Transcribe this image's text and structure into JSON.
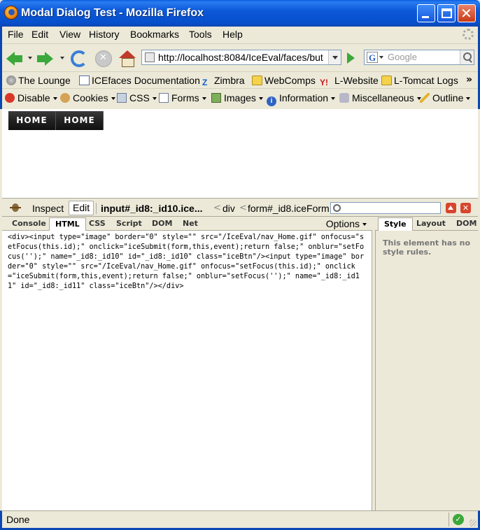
{
  "window": {
    "title": "Modal Dialog Test - Mozilla Firefox"
  },
  "menu": [
    "File",
    "Edit",
    "View",
    "History",
    "Bookmarks",
    "Tools",
    "Help"
  ],
  "nav": {
    "url": "http://localhost:8084/IceEval/faces/but",
    "search_placeholder": "Google",
    "search_engine_letter": "G"
  },
  "bookmarks": [
    "The Lounge",
    "ICEfaces Documentation",
    "Zimbra",
    "WebComps",
    "L-Website",
    "L-Tomcat Logs"
  ],
  "bookmarks_chevron": "»",
  "webdev": [
    "Disable",
    "Cookies",
    "CSS",
    "Forms",
    "Images",
    "Information",
    "Miscellaneous",
    "Outline"
  ],
  "page": {
    "buttons": [
      "HOME",
      "HOME"
    ]
  },
  "firebug": {
    "inspect_label": "Inspect",
    "edit_label": "Edit",
    "breadcrumb": [
      "input#_id8:_id10.ice...",
      "div",
      "form#_id8.iceForm"
    ],
    "breadcrumb_sep": "<",
    "tabs": [
      "Console",
      "HTML",
      "CSS",
      "Script",
      "DOM",
      "Net"
    ],
    "active_tab": "HTML",
    "options_label": "Options",
    "side_tabs": [
      "Style",
      "Layout",
      "DOM"
    ],
    "active_side_tab": "Style",
    "html_source": "<div><input type=\"image\" border=\"0\" style=\"\" src=\"/IceEval/nav_Home.gif\" onfocus=\"setFocus(this.id);\" onclick=\"iceSubmit(form,this,event);return false;\" onblur=\"setFocus('');\" name=\"_id8:_id10\" id=\"_id8:_id10\" class=\"iceBtn\"/><input type=\"image\" border=\"0\" style=\"\" src=\"/IceEval/nav_Home.gif\" onfocus=\"setFocus(this.id);\" onclick=\"iceSubmit(form,this,event);return false;\" onblur=\"setFocus('');\" name=\"_id8:_id11\" id=\"_id8:_id11\" class=\"iceBtn\"/></div>",
    "side_message": "This element has no style rules."
  },
  "status": {
    "text": "Done"
  },
  "colors": {
    "titlebar": "#0a5fe0",
    "page_button": "#222222",
    "ok": "#3aa83a"
  },
  "icons": [
    "firefox-icon",
    "back-arrow-icon",
    "forward-arrow-icon",
    "reload-icon",
    "stop-icon",
    "home-icon",
    "firebug-icon",
    "ok-check-icon"
  ]
}
